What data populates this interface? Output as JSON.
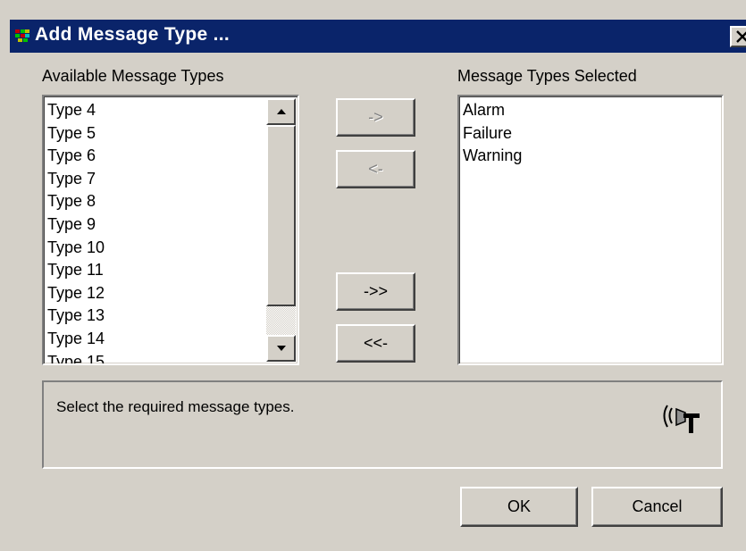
{
  "window": {
    "title": "Add Message Type ...",
    "close_symbol": "X"
  },
  "available": {
    "label": "Available Message Types",
    "items": [
      "Type  4",
      "Type  5",
      "Type  6",
      "Type  7",
      "Type  8",
      "Type  9",
      "Type 10",
      "Type 11",
      "Type 12",
      "Type 13",
      "Type 14",
      "Type 15"
    ]
  },
  "selected": {
    "label": "Message Types Selected",
    "items": [
      "Alarm",
      "Failure",
      "Warning"
    ]
  },
  "transfer_buttons": {
    "add": "->",
    "remove": "<-",
    "add_all": "->>",
    "remove_all": "<<-"
  },
  "info": {
    "text": "Select the required message types.",
    "icon": "speaker-icon"
  },
  "footer": {
    "ok": "OK",
    "cancel": "Cancel"
  }
}
